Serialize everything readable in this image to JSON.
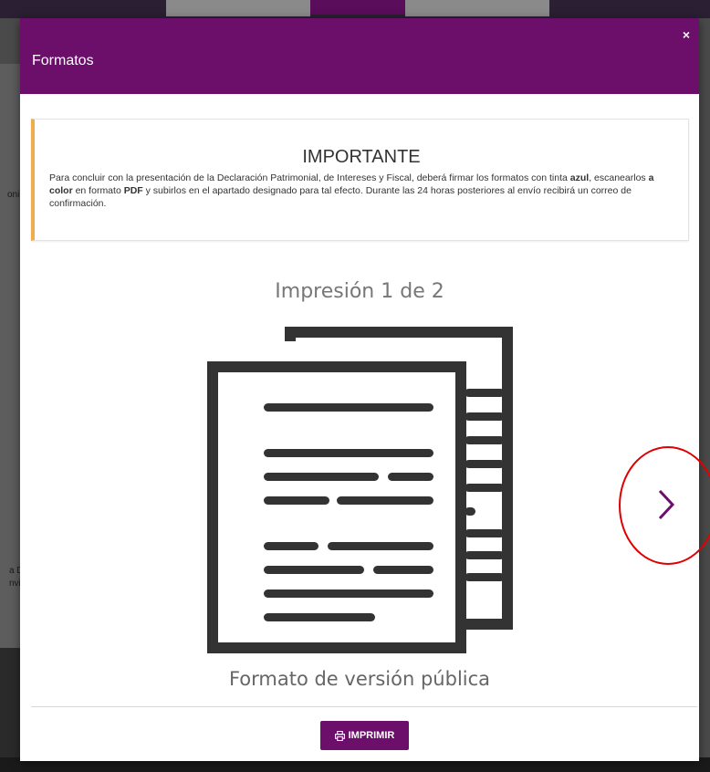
{
  "modal": {
    "title": "Formatos",
    "close_label": "×"
  },
  "notice": {
    "title": "IMPORTANTE",
    "text_1": "Para concluir con la presentación de la Declaración Patrimonial, de Intereses y Fiscal, deberá firmar los formatos con tinta ",
    "bold_1": "azul",
    "text_2": ", escanearlos ",
    "bold_2": "a color",
    "text_3": " en formato ",
    "bold_3": "PDF",
    "text_4": " y subirlos en el apartado designado para tal efecto. Durante las 24 horas posteriores al envío recibirá un correo de confirmación."
  },
  "carousel": {
    "heading": "Impresión 1 de 2",
    "caption": "Formato de versión pública",
    "next_icon": "chevron-right-icon"
  },
  "footer": {
    "print_label": "IMPRIMIR",
    "print_icon": "printer-icon"
  },
  "background": {
    "fragment_1": "onil",
    "fragment_2": "a D",
    "fragment_3": "nvi"
  },
  "colors": {
    "brand_purple": "#6b0f6b",
    "alert_accent": "#f0ad4e",
    "annotation_red": "#e00000"
  }
}
